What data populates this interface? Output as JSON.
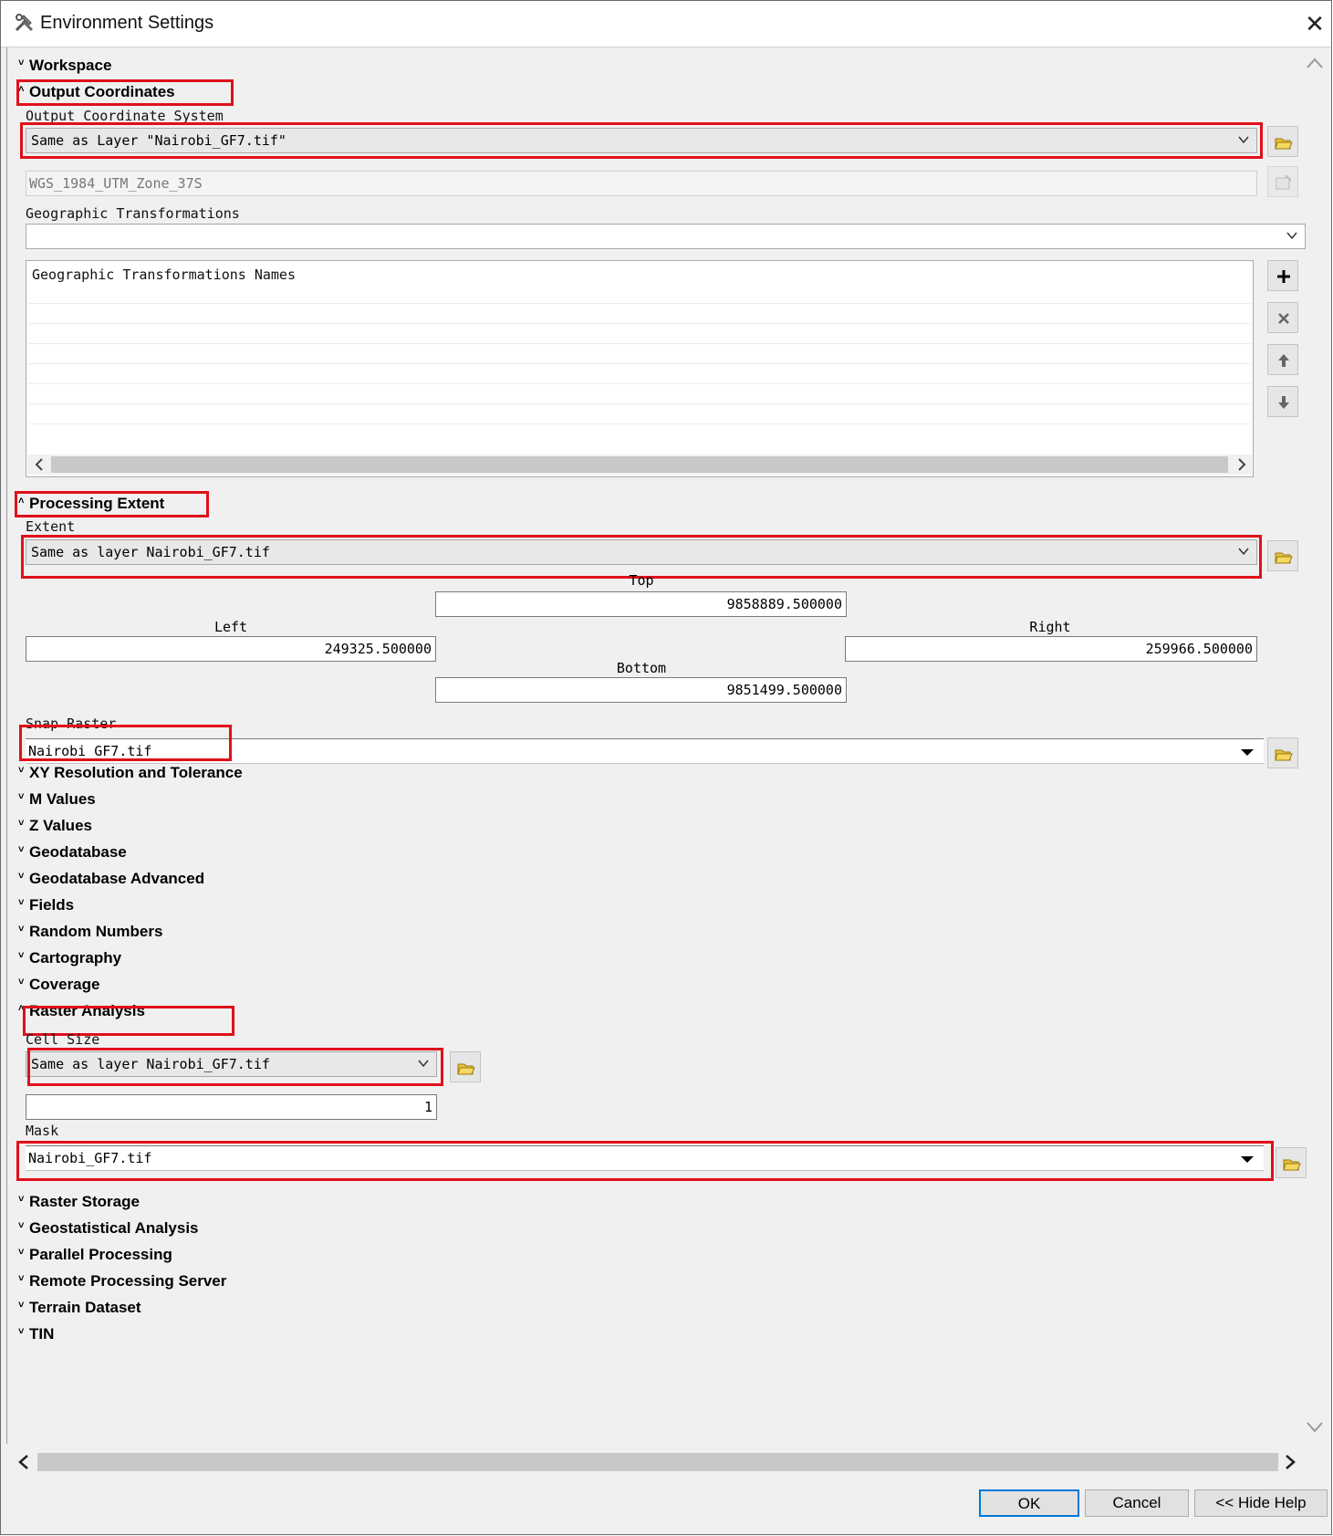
{
  "window": {
    "title": "Environment Settings",
    "icon": "tools-icon",
    "close_label": "✕"
  },
  "sections_top": {
    "workspace": "Workspace",
    "output_coordinates": "Output Coordinates"
  },
  "output_coordinates": {
    "ocs_label": "Output Coordinate System",
    "ocs_value": "Same as Layer \"Nairobi_GF7.tif\"",
    "crs_name": "WGS_1984_UTM_Zone_37S",
    "geo_trans_label": "Geographic Transformations",
    "geo_trans_value": "",
    "geo_trans_names_header": "Geographic Transformations Names",
    "buttons": [
      "plus-icon",
      "remove-icon",
      "arrow-up-icon",
      "arrow-down-icon"
    ]
  },
  "processing_extent": {
    "header": "Processing Extent",
    "extent_label": "Extent",
    "extent_value": "Same as layer Nairobi_GF7.tif",
    "top_label": "Top",
    "top_value": "9858889.500000",
    "left_label": "Left",
    "left_value": "249325.500000",
    "right_label": "Right",
    "right_value": "259966.500000",
    "bottom_label": "Bottom",
    "bottom_value": "9851499.500000",
    "snap_label": "Snap Raster",
    "snap_value": "Nairobi_GF7.tif"
  },
  "sections_mid": [
    "XY Resolution and Tolerance",
    "M Values",
    "Z Values",
    "Geodatabase",
    "Geodatabase Advanced",
    "Fields",
    "Random Numbers",
    "Cartography",
    "Coverage"
  ],
  "raster_analysis": {
    "header": "Raster Analysis",
    "cell_size_label": "Cell Size",
    "cell_size_value": "Same as layer Nairobi_GF7.tif",
    "cell_size_number": "1",
    "mask_label": "Mask",
    "mask_value": "Nairobi_GF7.tif"
  },
  "sections_bottom": [
    "Raster Storage",
    "Geostatistical Analysis",
    "Parallel Processing",
    "Remote Processing Server",
    "Terrain Dataset",
    "TIN"
  ],
  "footer": {
    "ok": "OK",
    "cancel": "Cancel",
    "hide_help": "<< Hide Help"
  },
  "colors": {
    "annotation_red": "#e0101a",
    "ok_border": "#0078d7"
  }
}
